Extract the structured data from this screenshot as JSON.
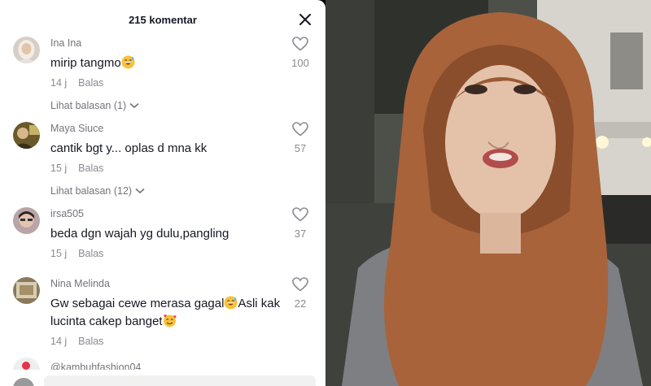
{
  "header": {
    "title": "215 komentar"
  },
  "comments": [
    {
      "username": "Ina Ina",
      "text": "mirip tangmo",
      "emoji": "grinning-sweat",
      "time": "14 j",
      "reply_label": "Balas",
      "likes": "100",
      "view_replies": "Lihat balasan (1)"
    },
    {
      "username": "Maya Siuce",
      "text": "cantik bgt y... oplas d mna kk",
      "time": "15 j",
      "reply_label": "Balas",
      "likes": "57",
      "view_replies": "Lihat balasan (12)"
    },
    {
      "username": "irsa505",
      "text": "beda dgn wajah yg dulu,pangling",
      "time": "15 j",
      "reply_label": "Balas",
      "likes": "37"
    },
    {
      "username": "Nina Melinda",
      "text_line1_a": "Gw sebagai cewe merasa gagal",
      "text_line1_b": "Asli kak",
      "text_line2": "lucinta cakep banget",
      "time": "14 j",
      "reply_label": "Balas",
      "likes": "22"
    }
  ],
  "partial_comment": {
    "username": "@kambuhfashion04"
  },
  "colors": {
    "text": "#161823",
    "muted": "#8a8b91",
    "accent": "#fe2c55"
  }
}
